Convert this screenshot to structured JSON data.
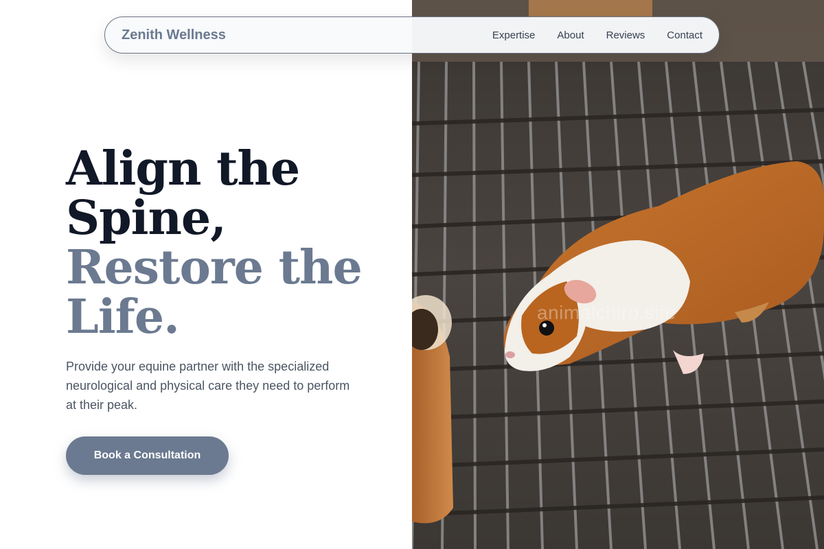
{
  "nav": {
    "brand": "Zenith Wellness",
    "links": [
      "Expertise",
      "About",
      "Reviews",
      "Contact"
    ]
  },
  "hero": {
    "headline_line1": "Align the",
    "headline_line2": "Spine,",
    "headline_line3": "Restore the",
    "headline_line4": "Life.",
    "subtext": "Provide your equine partner with the specialized neurological and physical care they need to perform at their peak.",
    "cta_label": "Book a Consultation"
  },
  "photo": {
    "watermark": "animalchiro.site",
    "subject": "guinea pig on wire cage grate"
  },
  "colors": {
    "primary": "#6b7a90",
    "headline_dark": "#111827",
    "body_text": "#4b5563"
  }
}
